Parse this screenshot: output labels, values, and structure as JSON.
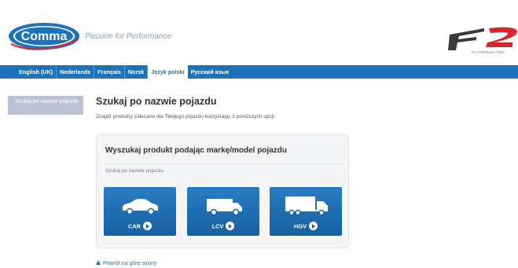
{
  "header": {
    "brand": "Comma",
    "tagline": "Passion for Performance",
    "partner_logo_text": "F2",
    "partner_logo_sub": "FIA FORMULA TWO"
  },
  "languages": [
    {
      "label": "English (UK)",
      "active": false
    },
    {
      "label": "Nederlands",
      "active": false
    },
    {
      "label": "Français",
      "active": false
    },
    {
      "label": "Norsk",
      "active": false
    },
    {
      "label": "Język polski",
      "active": true
    },
    {
      "label": "Русский язык",
      "active": false
    }
  ],
  "sidebar": {
    "items": [
      {
        "label": "Szukaj po nazwie pojazdu"
      }
    ]
  },
  "main": {
    "title": "Szukaj po nazwie pojazdu",
    "description": "Znajdź produkty zalecane dla Twojego pojazdu korzystając z poniższych opcji",
    "panel": {
      "title": "Wyszukaj produkt podając markę/model pojazdu",
      "subtitle": "Szukaj po nazwie pojazdu",
      "vehicles": [
        {
          "label": "CAR",
          "icon": "car-icon"
        },
        {
          "label": "LCV",
          "icon": "van-icon"
        },
        {
          "label": "HGV",
          "icon": "truck-icon"
        }
      ]
    },
    "back_to_top": "Powrót na górę strony"
  },
  "colors": {
    "brand_blue": "#1d73b9",
    "button_blue": "#1661a3",
    "sidebar_active": "#b8c4d3"
  }
}
